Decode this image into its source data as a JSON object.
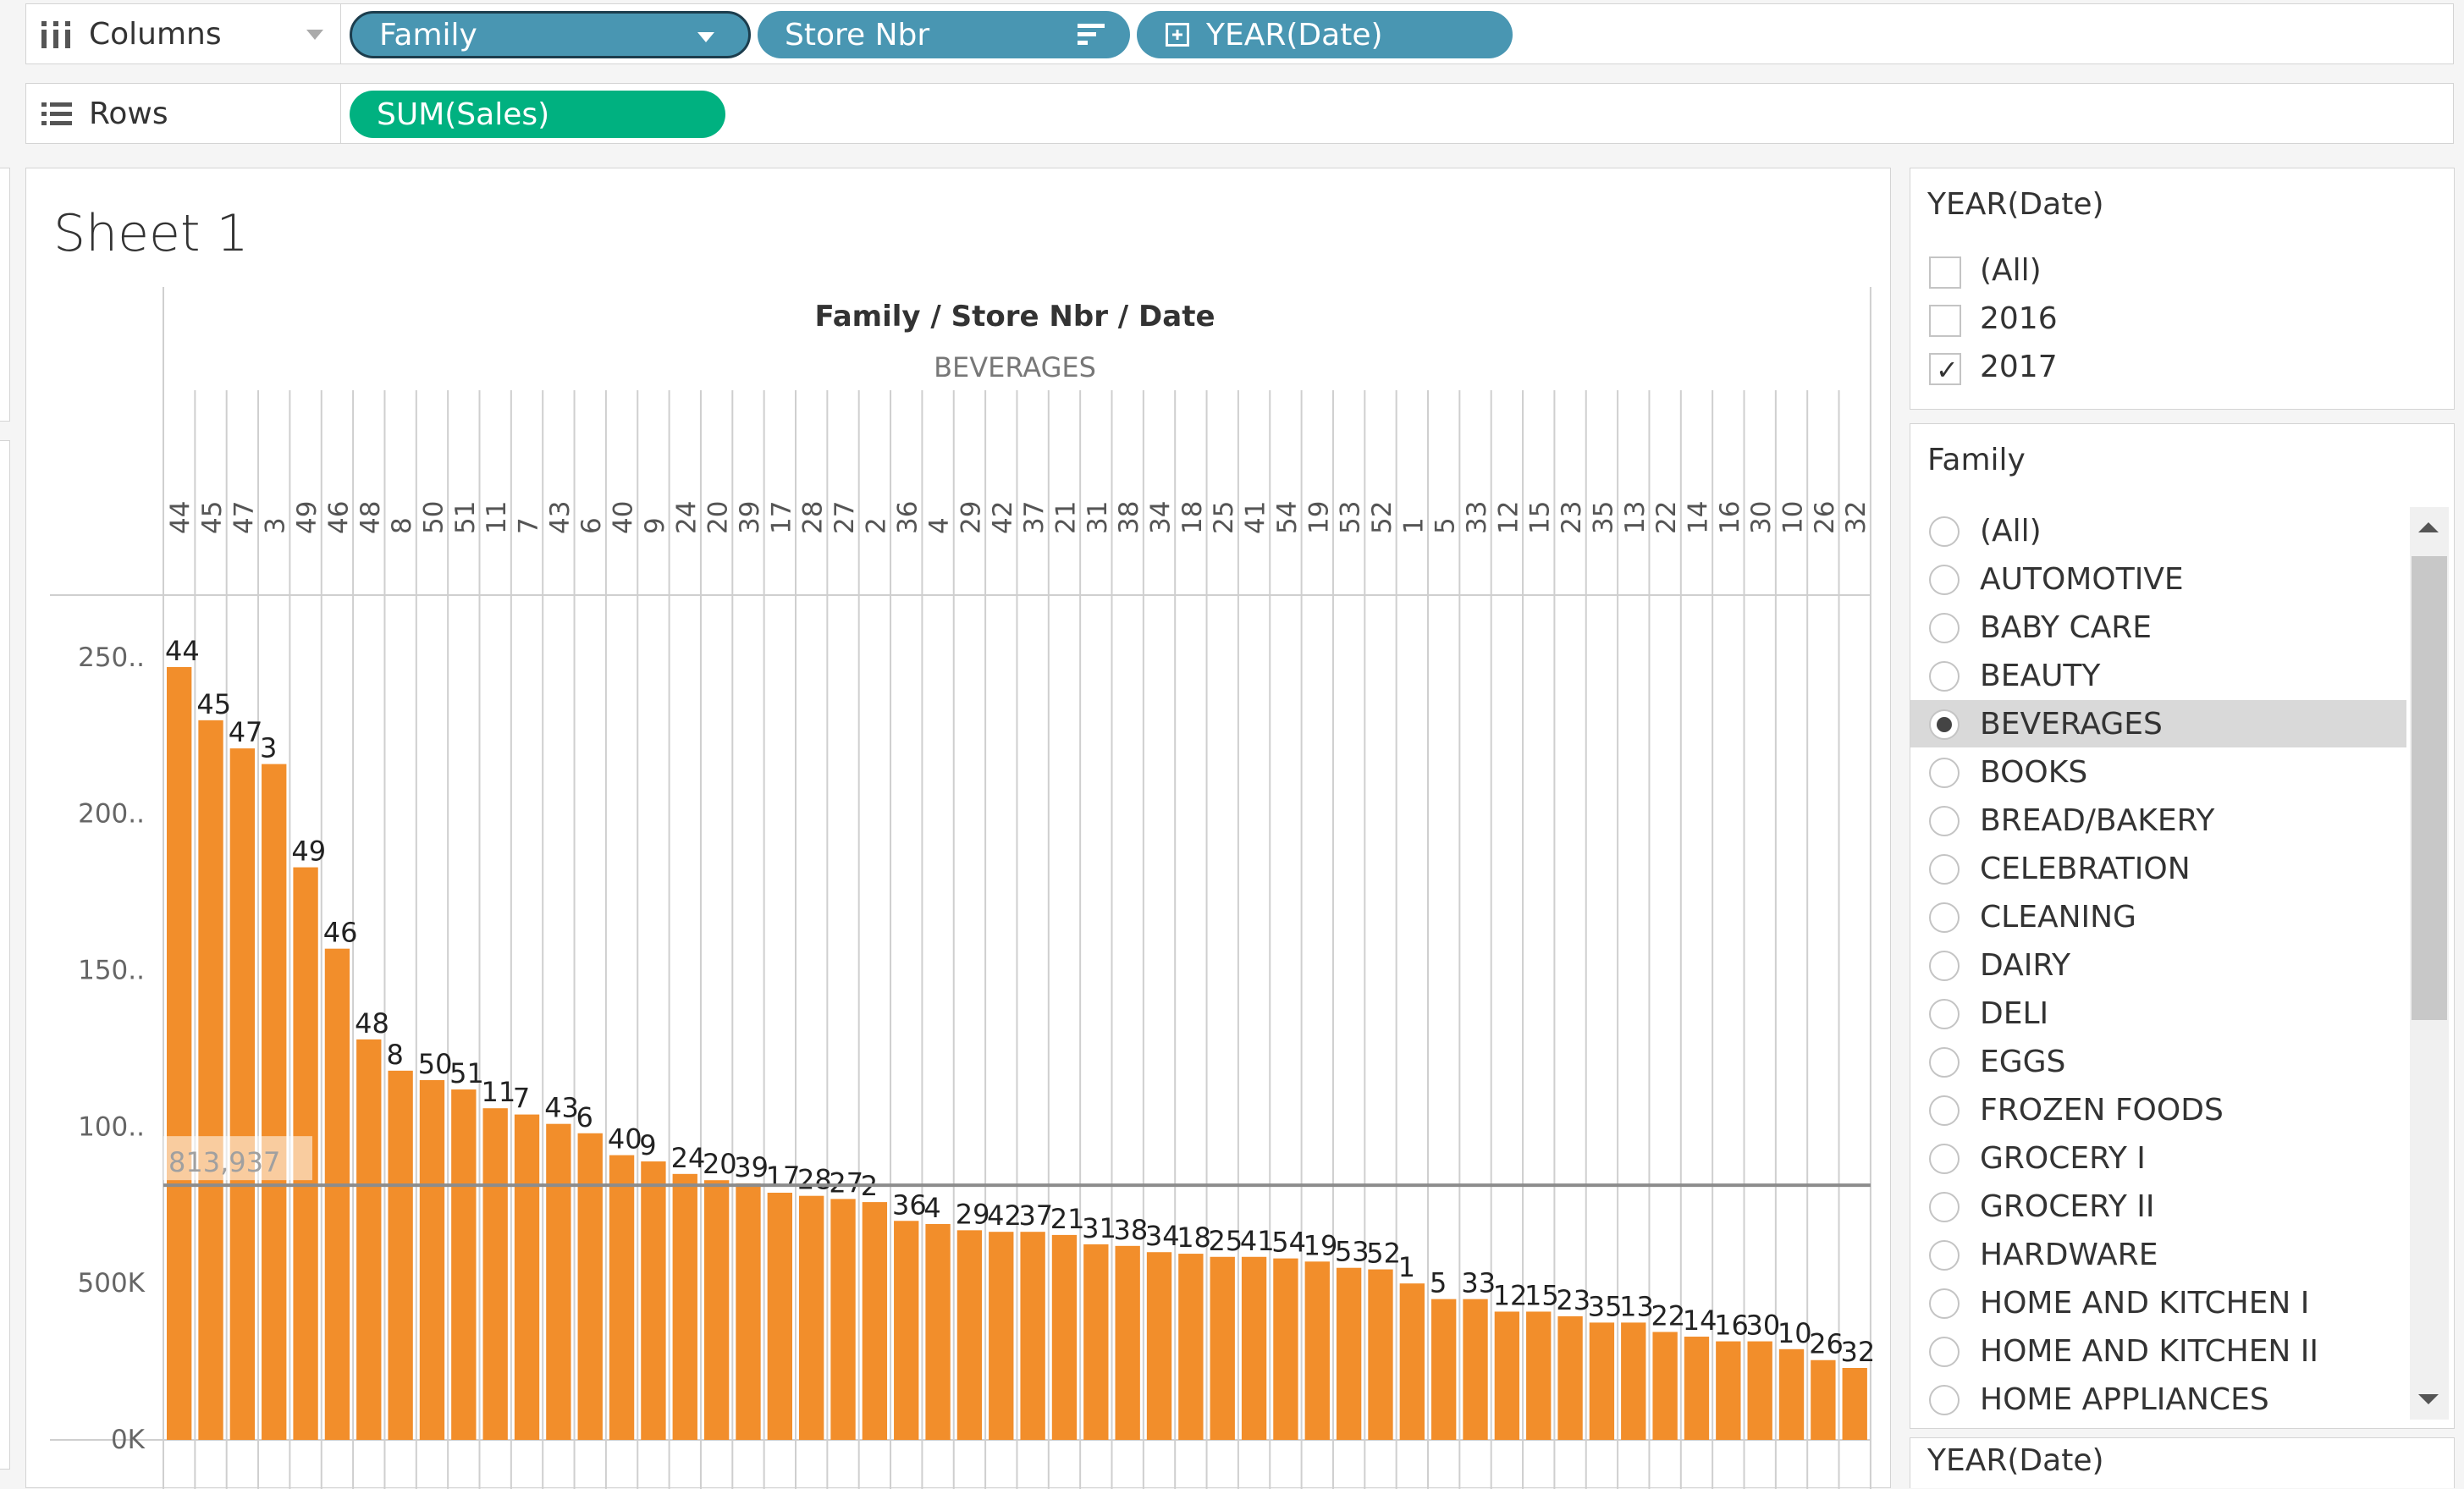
{
  "shelves": {
    "columns_label": "Columns",
    "rows_label": "Rows",
    "column_pills": [
      "Family",
      "Store Nbr",
      "YEAR(Date)"
    ],
    "row_pills": [
      "SUM(Sales)"
    ]
  },
  "sheet": {
    "title": "Sheet 1",
    "header_title": "Family  /  Store Nbr  /  Date",
    "family_header": "BEVERAGES"
  },
  "year_filter": {
    "title": "YEAR(Date)",
    "options": [
      {
        "label": "(All)",
        "checked": false
      },
      {
        "label": "2016",
        "checked": false
      },
      {
        "label": "2017",
        "checked": true
      }
    ]
  },
  "family_filter": {
    "title": "Family",
    "selected": "BEVERAGES",
    "options": [
      "(All)",
      "AUTOMOTIVE",
      "BABY CARE",
      "BEAUTY",
      "BEVERAGES",
      "BOOKS",
      "BREAD/BAKERY",
      "CELEBRATION",
      "CLEANING",
      "DAIRY",
      "DELI",
      "EGGS",
      "FROZEN FOODS",
      "GROCERY I",
      "GROCERY II",
      "HARDWARE",
      "HOME AND KITCHEN I",
      "HOME AND KITCHEN II",
      "HOME APPLIANCES"
    ]
  },
  "bottom_panel_title": "YEAR(Date)",
  "colors": {
    "bar": "#f28e2b",
    "pill_blue": "#4996b2",
    "pill_green": "#00b180",
    "reference_line": "#8c8c8c"
  },
  "chart_data": {
    "type": "bar",
    "ylim": [
      0,
      2700000
    ],
    "yticks": [
      {
        "value": 0,
        "label": "0K"
      },
      {
        "value": 500000,
        "label": "500K"
      },
      {
        "value": 1000000,
        "label": "100.."
      },
      {
        "value": 1500000,
        "label": "150.."
      },
      {
        "value": 2000000,
        "label": "200.."
      },
      {
        "value": 2500000,
        "label": "250.."
      }
    ],
    "reference_line": {
      "value": 813937,
      "label": "813,937"
    },
    "categories": [
      "44",
      "45",
      "47",
      "3",
      "49",
      "46",
      "48",
      "8",
      "50",
      "51",
      "11",
      "7",
      "43",
      "6",
      "40",
      "9",
      "24",
      "20",
      "39",
      "17",
      "28",
      "27",
      "2",
      "36",
      "4",
      "29",
      "42",
      "37",
      "21",
      "31",
      "38",
      "34",
      "18",
      "25",
      "41",
      "54",
      "19",
      "53",
      "52",
      "1",
      "5",
      "33",
      "12",
      "15",
      "23",
      "35",
      "13",
      "22",
      "14",
      "16",
      "30",
      "10",
      "26",
      "32"
    ],
    "bar_labels": [
      "44",
      "45",
      "47",
      "3",
      "49",
      "46",
      "48",
      "8",
      "50",
      "51",
      "11",
      "7",
      "43",
      "6",
      "40",
      "9",
      "24",
      "20",
      "39",
      "17",
      "28",
      "27",
      "2",
      "36",
      "4",
      "29",
      "42",
      "37",
      "21",
      "31",
      "38",
      "34",
      "18",
      "25",
      "41",
      "54",
      "19",
      "53",
      "52",
      "1",
      "5",
      "33",
      "12",
      "15",
      "23",
      "35",
      "13",
      "22",
      "14",
      "16",
      "30",
      "10",
      "26",
      "32"
    ],
    "values": [
      2470000,
      2300000,
      2210000,
      2160000,
      1830000,
      1570000,
      1280000,
      1180000,
      1150000,
      1120000,
      1060000,
      1040000,
      1010000,
      980000,
      910000,
      890000,
      850000,
      830000,
      820000,
      790000,
      780000,
      770000,
      760000,
      700000,
      690000,
      670000,
      665000,
      665000,
      655000,
      625000,
      620000,
      600000,
      595000,
      585000,
      585000,
      580000,
      570000,
      550000,
      545000,
      500000,
      450000,
      450000,
      410000,
      410000,
      395000,
      375000,
      375000,
      345000,
      330000,
      315000,
      315000,
      290000,
      255000,
      230000
    ]
  }
}
